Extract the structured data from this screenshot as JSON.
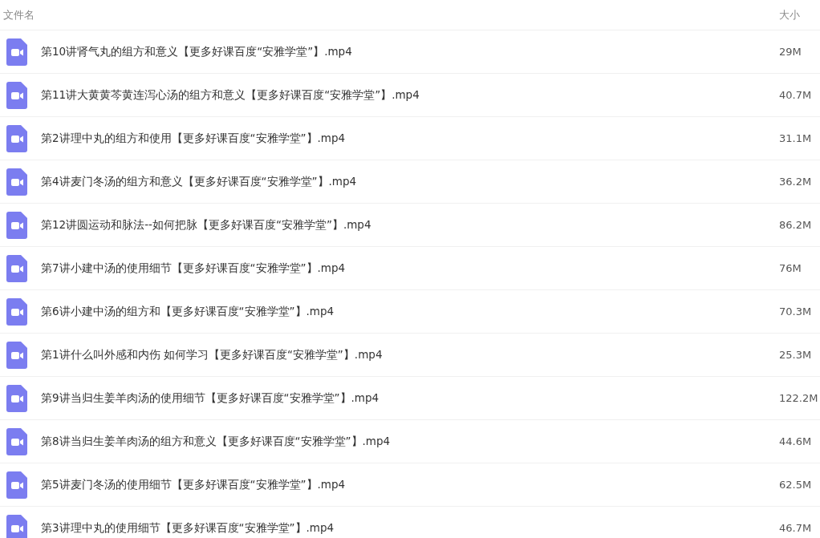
{
  "columns": [
    "文件名",
    "大小"
  ],
  "files": [
    {
      "name": "第10讲肾气丸的组方和意义【更多好课百度“安雅学堂”】.mp4",
      "size": "29M"
    },
    {
      "name": "第11讲大黄黄芩黄连泻心汤的组方和意义【更多好课百度“安雅学堂”】.mp4",
      "size": "40.7M"
    },
    {
      "name": "第2讲理中丸的组方和使用【更多好课百度“安雅学堂”】.mp4",
      "size": "31.1M"
    },
    {
      "name": "第4讲麦门冬汤的组方和意义【更多好课百度“安雅学堂”】.mp4",
      "size": "36.2M"
    },
    {
      "name": "第12讲圆运动和脉法--如何把脉【更多好课百度“安雅学堂”】.mp4",
      "size": "86.2M"
    },
    {
      "name": "第7讲小建中汤的使用细节【更多好课百度“安雅学堂”】.mp4",
      "size": "76M"
    },
    {
      "name": "第6讲小建中汤的组方和【更多好课百度“安雅学堂”】.mp4",
      "size": "70.3M"
    },
    {
      "name": "第1讲什么叫外感和内伤 如何学习【更多好课百度“安雅学堂”】.mp4",
      "size": "25.3M"
    },
    {
      "name": "第9讲当归生姜羊肉汤的使用细节【更多好课百度“安雅学堂”】.mp4",
      "size": "122.2M"
    },
    {
      "name": "第8讲当归生姜羊肉汤的组方和意义【更多好课百度“安雅学堂”】.mp4",
      "size": "44.6M"
    },
    {
      "name": "第5讲麦门冬汤的使用细节【更多好课百度“安雅学堂”】.mp4",
      "size": "62.5M"
    },
    {
      "name": "第3讲理中丸的使用细节【更多好课百度“安雅学堂”】.mp4",
      "size": "46.7M"
    }
  ]
}
